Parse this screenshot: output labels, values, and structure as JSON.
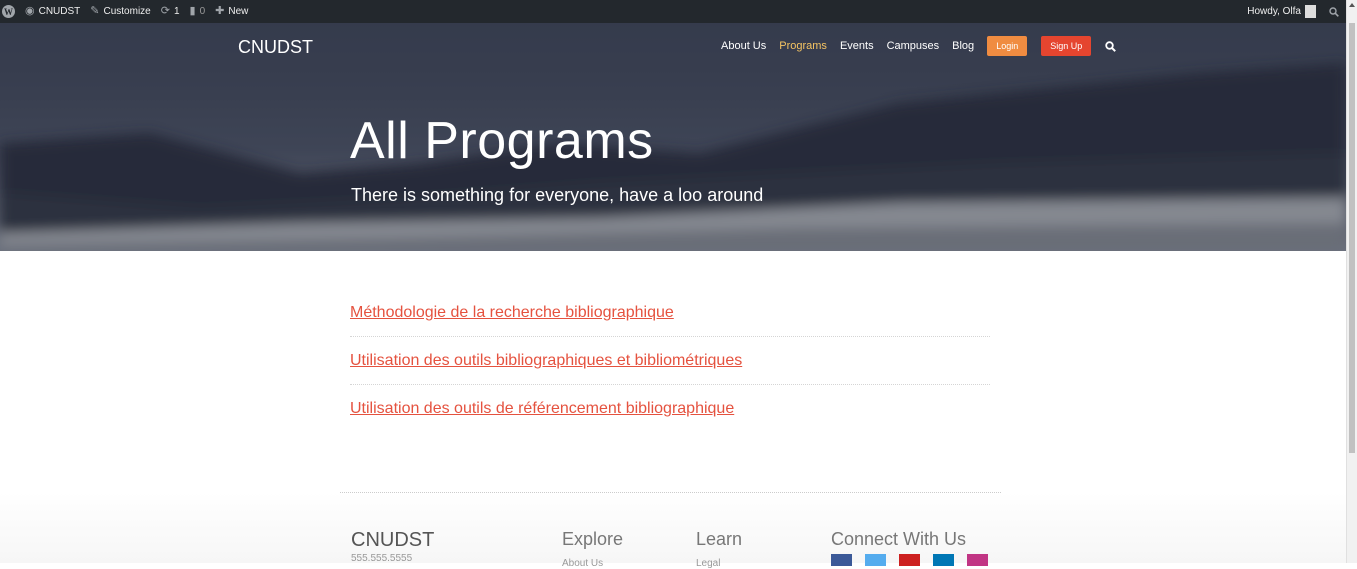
{
  "adminbar": {
    "site_name": "CNUDST",
    "customize": "Customize",
    "updates_count": "1",
    "comments_count": "0",
    "new_label": "New",
    "howdy": "Howdy, Olfa"
  },
  "header": {
    "brand": "CNUDST",
    "nav": [
      "About Us",
      "Programs",
      "Events",
      "Campuses",
      "Blog"
    ],
    "active_nav": "Programs",
    "login_label": "Login",
    "signup_label": "Sign Up"
  },
  "hero": {
    "title": "All Programs",
    "subtitle": "There is something for everyone, have a loo around"
  },
  "programs": [
    "Méthodologie de la recherche bibliographique",
    "Utilisation des outils bibliographiques et bibliométriques",
    "Utilisation des outils de référencement bibliographique"
  ],
  "footer": {
    "brand": "CNUDST",
    "phone": "555.555.5555",
    "explore_heading": "Explore",
    "explore_first": "About Us",
    "learn_heading": "Learn",
    "learn_first": "Legal",
    "connect_heading": "Connect With Us"
  },
  "colors": {
    "accent_link": "#e5523f",
    "login_btn": "#f08c41",
    "signup_btn": "#e5452f",
    "active_nav": "#f5c463",
    "adminbar_bg": "#23282d",
    "facebook": "#3b5998",
    "twitter": "#55acee",
    "youtube": "#cd201f",
    "linkedin": "#0077b5",
    "instagram": "#c13584"
  },
  "icons": [
    "wordpress-icon",
    "dashboard-icon",
    "brush-icon",
    "refresh-icon",
    "comment-icon",
    "plus-icon",
    "search-icon",
    "facebook-icon",
    "twitter-icon",
    "youtube-icon",
    "linkedin-icon",
    "instagram-icon"
  ]
}
